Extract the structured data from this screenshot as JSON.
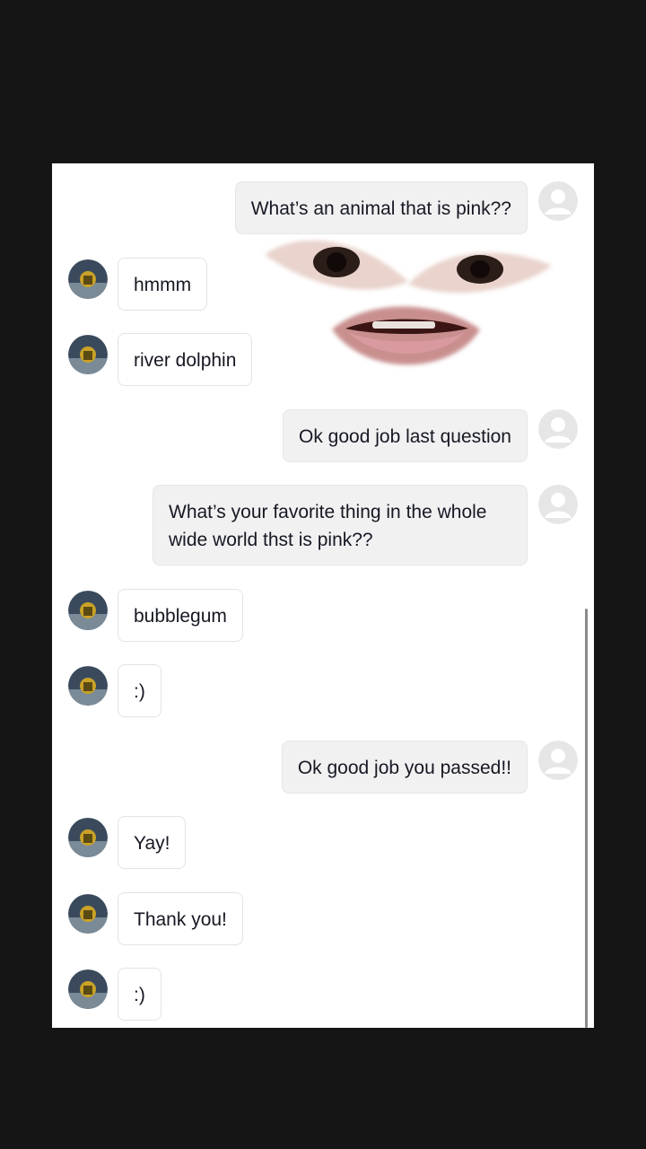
{
  "conversation": {
    "messages": [
      {
        "sender": "me",
        "text": "What’s an animal that is pink??"
      },
      {
        "sender": "them",
        "text": "hmmm"
      },
      {
        "sender": "them",
        "text": "river dolphin"
      },
      {
        "sender": "me",
        "text": "Ok good job last question"
      },
      {
        "sender": "me",
        "text": "What’s your favorite thing in the whole wide world thst is pink??"
      },
      {
        "sender": "them",
        "text": "bubblegum"
      },
      {
        "sender": "them",
        "text": ":)"
      },
      {
        "sender": "me",
        "text": "Ok good job you passed!!"
      },
      {
        "sender": "them",
        "text": "Yay!"
      },
      {
        "sender": "them",
        "text": "Thank you!"
      },
      {
        "sender": "them",
        "text": ":)"
      }
    ]
  },
  "colors": {
    "background": "#151515",
    "panel": "#ffffff",
    "my_bubble": "#f1f1f2",
    "their_bubble": "#ffffff",
    "text": "#161823"
  },
  "icons": {
    "my_avatar": "default-user-icon",
    "their_avatar": "profile-photo-icon"
  }
}
